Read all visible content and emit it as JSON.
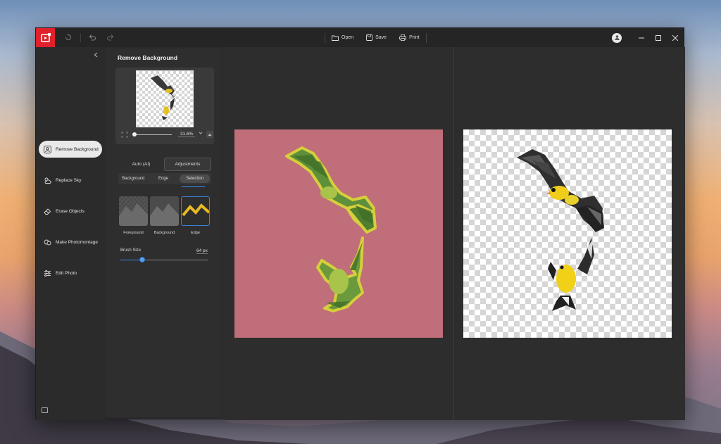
{
  "titlebar": {
    "open_label": "Open",
    "save_label": "Save",
    "print_label": "Print"
  },
  "nav": {
    "items": [
      {
        "label": "Remove Background",
        "icon": "person-cutout-icon",
        "active": true
      },
      {
        "label": "Replace Sky",
        "icon": "cloud-sun-icon",
        "active": false
      },
      {
        "label": "Erase Objects",
        "icon": "eraser-icon",
        "active": false
      },
      {
        "label": "Make Photomontage",
        "icon": "layers-icon",
        "active": false
      },
      {
        "label": "Edit Photo",
        "icon": "sliders-icon",
        "active": false
      }
    ]
  },
  "panel": {
    "title": "Remove Background",
    "zoom": "31.6%",
    "mode_tabs": [
      "Auto (AI)",
      "Adjustments"
    ],
    "active_mode": "Adjustments",
    "sub_tabs": [
      "Background",
      "Edge",
      "Selection"
    ],
    "active_sub_tab": "Selection",
    "tiles": [
      "Foreground",
      "Background",
      "Edge"
    ],
    "selected_tile": "Edge",
    "brush_label": "Brush Size",
    "brush_value": "64 px",
    "brush_level": 0.25
  },
  "colors": {
    "accent": "#3b8ee8",
    "brand": "#e0202a",
    "before_bg": "#c06e79",
    "edge_yellow": "#e8b923"
  }
}
